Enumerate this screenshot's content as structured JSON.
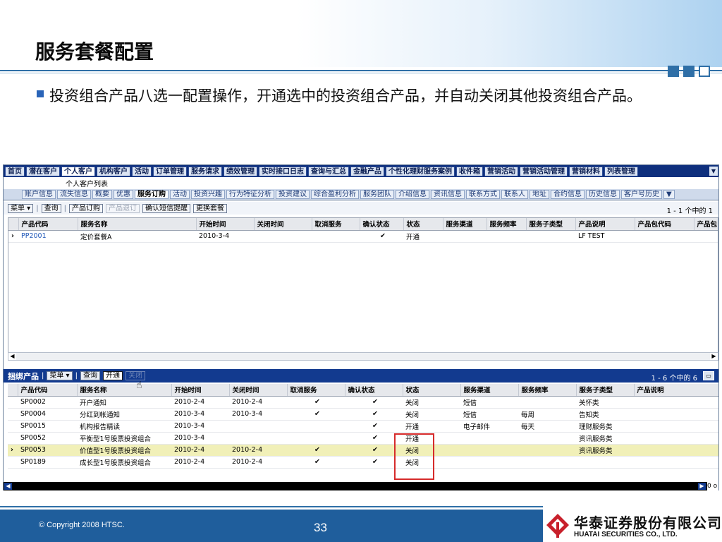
{
  "slide": {
    "title": "服务套餐配置",
    "bullet": "投资组合产品八选一配置操作，开通选中的投资组合产品，并自动关闭其他投资组合产品。",
    "copyright": "© Copyright 2008 HTSC.",
    "page_number": "33",
    "logo_cn": "华泰证券股份有限公司",
    "logo_en": "HUATAI SECURITIES CO., LTD."
  },
  "nav_tabs": [
    "首页",
    "潜在客户",
    "个人客户",
    "机构客户",
    "活动",
    "订单管理",
    "服务请求",
    "绩效管理",
    "实时接口日志",
    "查询与汇总",
    "金融产品",
    "个性化理财服务案例",
    "收件箱",
    "营销活动",
    "营销活动管理",
    "营销材料",
    "列表管理"
  ],
  "nav_active": "个人客户",
  "subtitle": "个人客户列表",
  "sub_tabs": [
    "账户信息",
    "流失信息",
    "概要",
    "优惠",
    "服务订购",
    "活动",
    "投资兴趣",
    "行为特征分析",
    "投资建议",
    "综合盈利分析",
    "服务团队",
    "介绍信息",
    "资讯信息",
    "联系方式",
    "联系人",
    "地址",
    "合约信息",
    "历史信息",
    "客户号历史"
  ],
  "sub_active": "服务订购",
  "toolbar1": {
    "menu": "菜单 ▾",
    "query": "查询",
    "order": "产品订购",
    "unsubscribe": "产品退订",
    "confirm_sms": "确认短信提醒",
    "change_package": "更换套餐",
    "page_info": "1 - 1 个中的 1"
  },
  "grid1": {
    "headers": [
      "产品代码",
      "服务名称",
      "开始时间",
      "关闭时间",
      "取消服务",
      "确认状态",
      "状态",
      "服务渠道",
      "服务频率",
      "服务子类型",
      "产品说明",
      "产品包代码",
      "产品包"
    ],
    "rows": [
      {
        "sel": "›",
        "code": "PP2001",
        "name": "定价套餐A",
        "start": "2010-3-4",
        "end": "",
        "cancel": "",
        "confirm": "✔",
        "status": "开通",
        "channel": "",
        "freq": "",
        "subtype": "",
        "desc": "LF TEST",
        "pkgcode": "",
        "pkg": ""
      }
    ]
  },
  "toolbar2": {
    "title": "捆绑产品",
    "menu": "菜单 ▾",
    "query": "查询",
    "open": "开通",
    "close": "关闭",
    "page_info": "1 - 6 个中的 6"
  },
  "grid2": {
    "headers": [
      "产品代码",
      "服务名称",
      "开始时间",
      "关闭时间",
      "取消服务",
      "确认状态",
      "状态",
      "服务渠道",
      "服务频率",
      "服务子类型",
      "产品说明"
    ],
    "rows": [
      {
        "sel": "",
        "code": "SP0002",
        "name": "开户通知",
        "start": "2010-2-4",
        "end": "2010-2-4",
        "cancel": "✔",
        "confirm": "✔",
        "status": "关闭",
        "channel": "短信",
        "freq": "",
        "subtype": "关怀类",
        "desc": ""
      },
      {
        "sel": "",
        "code": "SP0004",
        "name": "分红到帐通知",
        "start": "2010-3-4",
        "end": "2010-3-4",
        "cancel": "✔",
        "confirm": "✔",
        "status": "关闭",
        "channel": "短信",
        "freq": "每周",
        "subtype": "告知类",
        "desc": ""
      },
      {
        "sel": "",
        "code": "SP0015",
        "name": "机构报告精读",
        "start": "2010-3-4",
        "end": "",
        "cancel": "",
        "confirm": "✔",
        "status": "开通",
        "channel": "电子邮件",
        "freq": "每天",
        "subtype": "理财服务类",
        "desc": ""
      },
      {
        "sel": "",
        "code": "SP0052",
        "name": "平衡型1号股票投资组合",
        "start": "2010-3-4",
        "end": "",
        "cancel": "",
        "confirm": "✔",
        "status": "开通",
        "channel": "",
        "freq": "",
        "subtype": "资讯服务类",
        "desc": ""
      },
      {
        "sel": "›",
        "code": "SP0053",
        "name": "价值型1号股票投资组合",
        "start": "2010-2-4",
        "end": "2010-2-4",
        "cancel": "✔",
        "confirm": "✔",
        "status": "关闭",
        "channel": "",
        "freq": "",
        "subtype": "资讯服务类",
        "desc": ""
      },
      {
        "sel": "",
        "code": "SP0189",
        "name": "成长型1号股票投资组合",
        "start": "2010-2-4",
        "end": "2010-2-4",
        "cancel": "✔",
        "confirm": "✔",
        "status": "关闭",
        "channel": "",
        "freq": "",
        "subtype": "",
        "desc": ""
      }
    ],
    "highlight_row": 4
  },
  "scroll_tail": "0 o",
  "icons": [
    "dropdown-arrow-icon",
    "scroll-left-icon",
    "scroll-right-icon",
    "print-icon",
    "hand-cursor-icon",
    "huatai-logo-icon"
  ]
}
